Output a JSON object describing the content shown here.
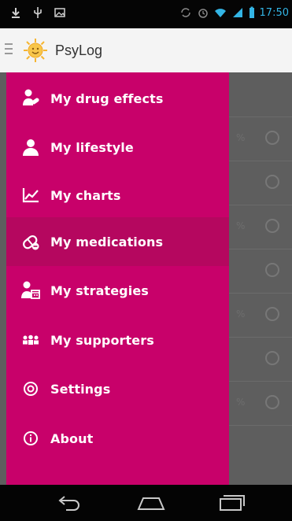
{
  "status_bar": {
    "time": "17:50"
  },
  "app_bar": {
    "title": "PsyLog"
  },
  "drawer": {
    "items": [
      {
        "label": "My drug effects",
        "icon": "person-pill-icon"
      },
      {
        "label": "My lifestyle",
        "icon": "person-icon"
      },
      {
        "label": "My charts",
        "icon": "line-chart-icon"
      },
      {
        "label": "My medications",
        "icon": "pill-icon",
        "active": true
      },
      {
        "label": "My strategies",
        "icon": "person-calendar-icon"
      },
      {
        "label": "My supporters",
        "icon": "people-icon"
      },
      {
        "label": "Settings",
        "icon": "gear-icon"
      },
      {
        "label": "About",
        "icon": "info-icon"
      }
    ]
  },
  "colors": {
    "drawer": "#c8016a",
    "drawer_active": "#b5075f",
    "status_accent": "#33b5e5"
  }
}
